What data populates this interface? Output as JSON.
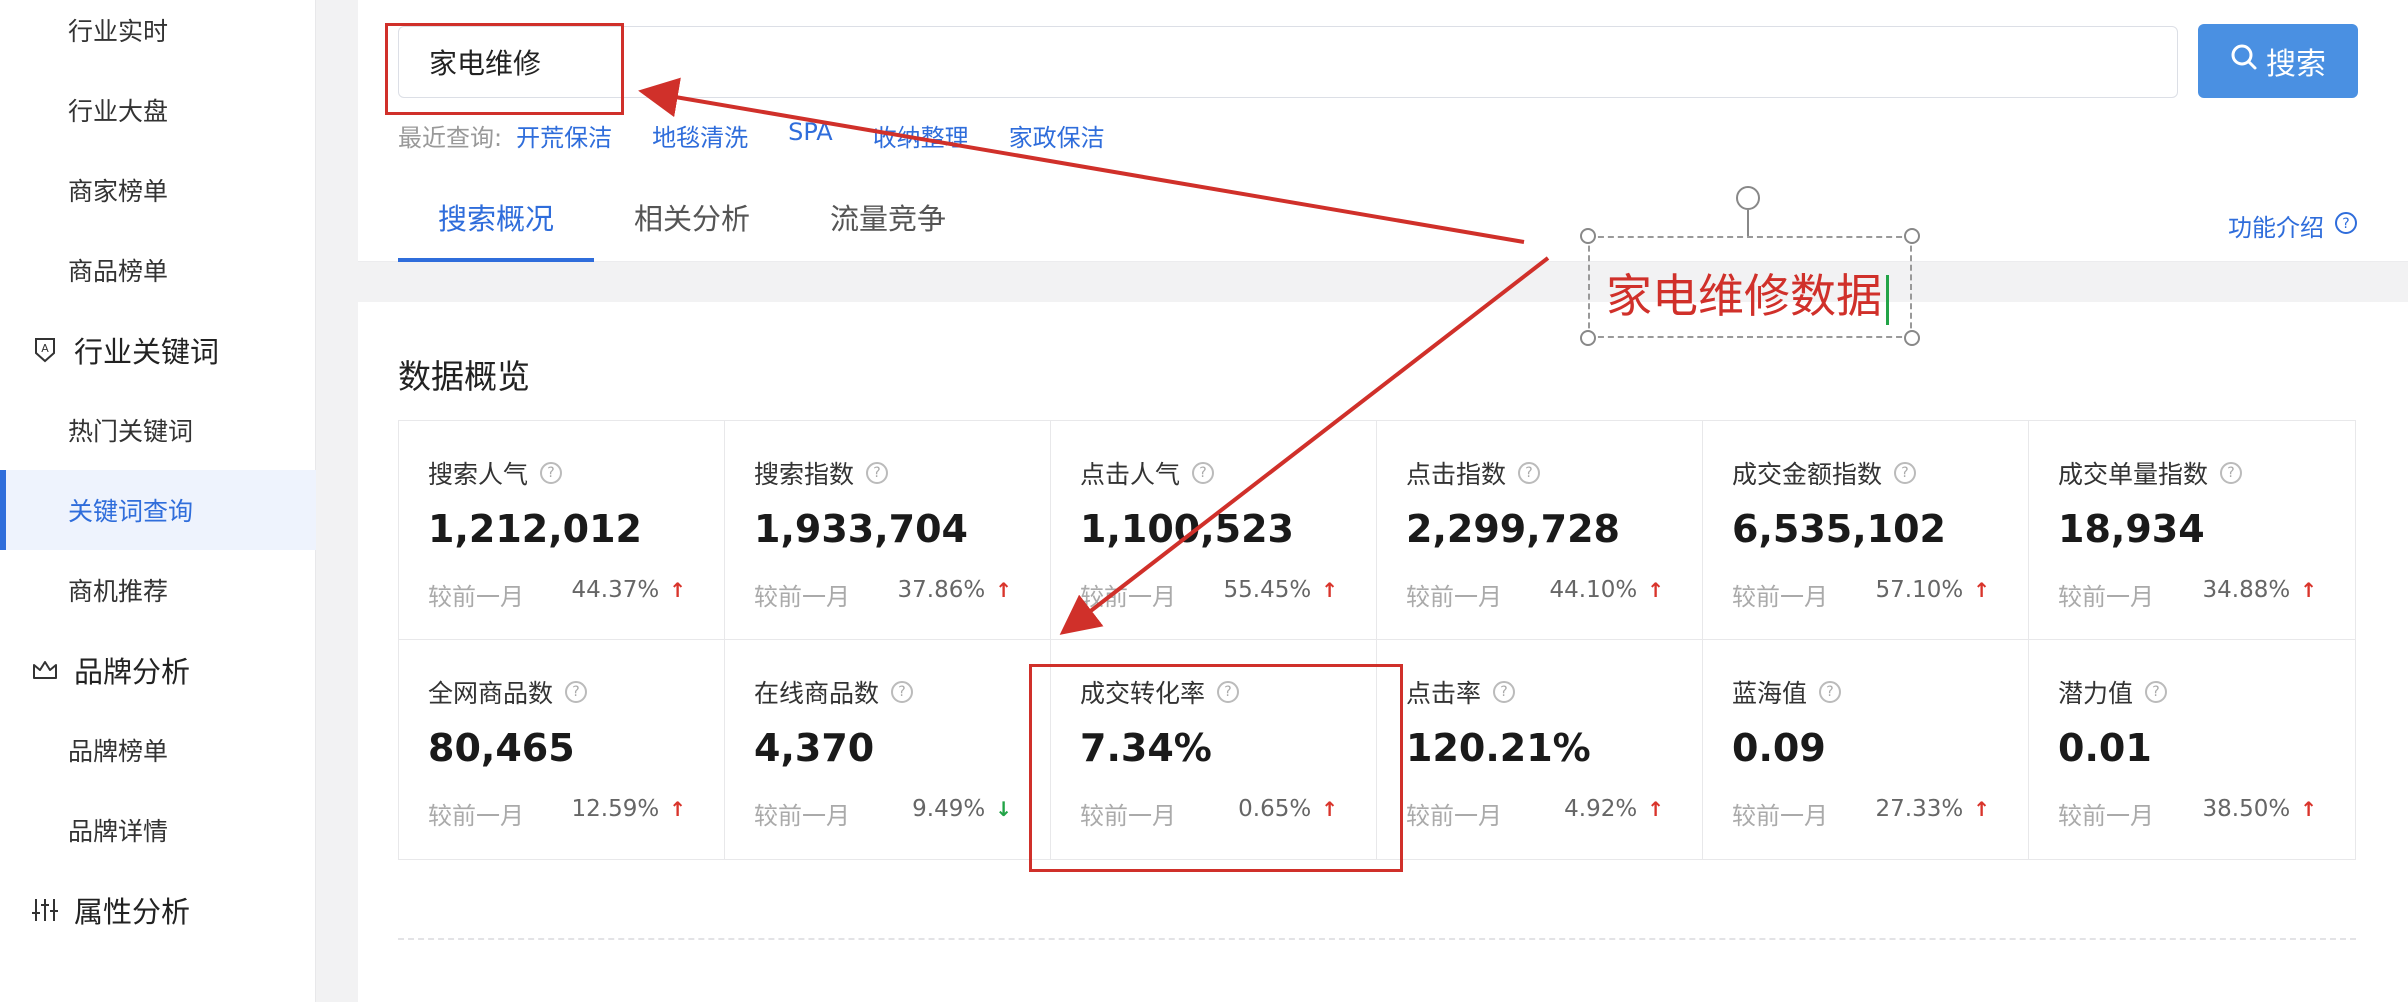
{
  "sidebar": {
    "items": [
      {
        "label": "行业实时",
        "type": "item",
        "active": false
      },
      {
        "label": "行业大盘",
        "type": "item",
        "active": false
      },
      {
        "label": "商家榜单",
        "type": "item",
        "active": false
      },
      {
        "label": "商品榜单",
        "type": "item",
        "active": false
      },
      {
        "label": "行业关键词",
        "type": "group",
        "icon": "keyword-shield-icon"
      },
      {
        "label": "热门关键词",
        "type": "item",
        "active": false
      },
      {
        "label": "关键词查询",
        "type": "item",
        "active": true
      },
      {
        "label": "商机推荐",
        "type": "item",
        "active": false
      },
      {
        "label": "品牌分析",
        "type": "group",
        "icon": "crown-icon"
      },
      {
        "label": "品牌榜单",
        "type": "item",
        "active": false
      },
      {
        "label": "品牌详情",
        "type": "item",
        "active": false
      },
      {
        "label": "属性分析",
        "type": "group",
        "icon": "sliders-icon"
      }
    ]
  },
  "search": {
    "value": "家电维修",
    "button_label": "搜索",
    "recent_label": "最近查询:",
    "recent": [
      "开荒保洁",
      "地毯清洗",
      "SPA",
      "收纳整理",
      "家政保洁"
    ]
  },
  "tabs": [
    {
      "label": "搜索概况",
      "active": true
    },
    {
      "label": "相关分析",
      "active": false
    },
    {
      "label": "流量竞争",
      "active": false
    }
  ],
  "func_intro": "功能介绍",
  "overview": {
    "title": "数据概览",
    "compare_label": "较前一月",
    "metrics": [
      {
        "label": "搜索人气",
        "value": "1,212,012",
        "pct": "44.37%",
        "trend": "up"
      },
      {
        "label": "搜索指数",
        "value": "1,933,704",
        "pct": "37.86%",
        "trend": "up"
      },
      {
        "label": "点击人气",
        "value": "1,100,523",
        "pct": "55.45%",
        "trend": "up"
      },
      {
        "label": "点击指数",
        "value": "2,299,728",
        "pct": "44.10%",
        "trend": "up"
      },
      {
        "label": "成交金额指数",
        "value": "6,535,102",
        "pct": "57.10%",
        "trend": "up"
      },
      {
        "label": "成交单量指数",
        "value": "18,934",
        "pct": "34.88%",
        "trend": "up"
      },
      {
        "label": "全网商品数",
        "value": "80,465",
        "pct": "12.59%",
        "trend": "up"
      },
      {
        "label": "在线商品数",
        "value": "4,370",
        "pct": "9.49%",
        "trend": "down"
      },
      {
        "label": "成交转化率",
        "value": "7.34%",
        "pct": "0.65%",
        "trend": "up"
      },
      {
        "label": "点击率",
        "value": "120.21%",
        "pct": "4.92%",
        "trend": "up"
      },
      {
        "label": "蓝海值",
        "value": "0.09",
        "pct": "27.33%",
        "trend": "up"
      },
      {
        "label": "潜力值",
        "value": "0.01",
        "pct": "38.50%",
        "trend": "up"
      }
    ]
  },
  "annotation": {
    "text": "家电维修数据",
    "color": "#d0302a"
  },
  "colors": {
    "accent": "#2f6ddb",
    "button": "#4a90e2",
    "up": "#d9342b",
    "down": "#22a447"
  }
}
